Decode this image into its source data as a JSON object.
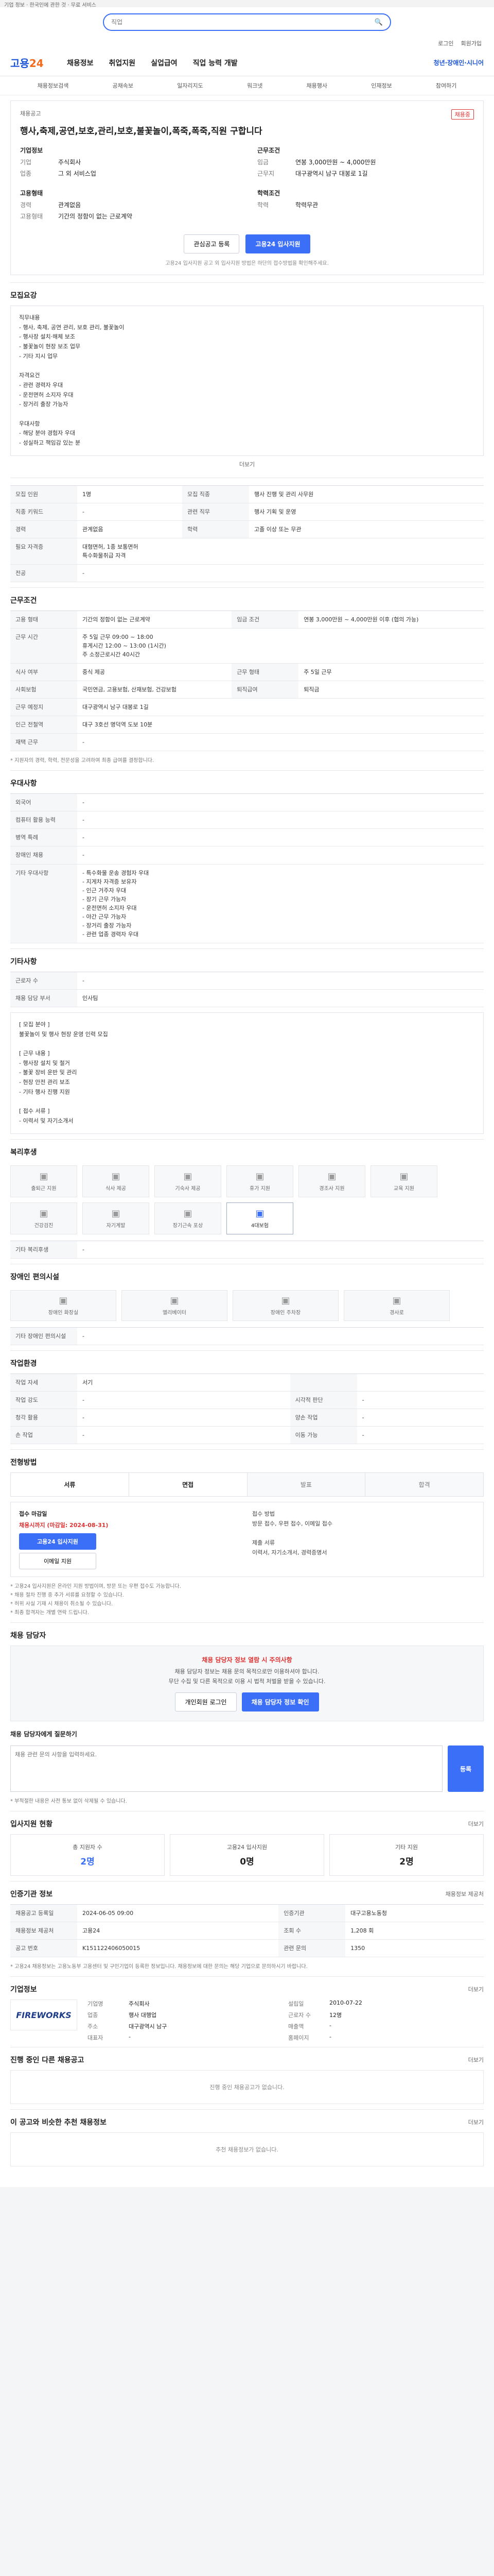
{
  "topnote": "기업 정보 · 한국인에 관한 것 · 무료 서비스",
  "search": {
    "placeholder": "직업",
    "icon": "search-icon"
  },
  "util": [
    "로그인",
    "회원가입"
  ],
  "brand": {
    "logo": "고용",
    "logo_suffix": "24"
  },
  "gnb": {
    "menu": [
      "채용정보",
      "취업지원",
      "실업급여",
      "직업 능력 개발"
    ],
    "extra": "청년·장애인·시니어"
  },
  "subnav": [
    "채용정보검색",
    "공채속보",
    "일자리지도",
    "워크넷",
    "채용행사",
    "인재정보",
    "참여하기"
  ],
  "job": {
    "label": "채용공고",
    "badge": "채용중",
    "title": "행사,축제,공연,보호,관리,보호,불꽃놀이,폭죽,폭죽,직원 구합니다",
    "company_title": "기업정보",
    "company_rows": [
      {
        "k": "기업",
        "v": "주식회사"
      },
      {
        "k": "업종",
        "v": "그 외 서비스업"
      }
    ],
    "cond_title": "근무조건",
    "cond_rows": [
      {
        "k": "임금",
        "v": "연봉 3,000만원 ~ 4,000만원"
      },
      {
        "k": "근무지",
        "v": "대구광역시 남구 대봉로 1길"
      }
    ],
    "career_title": "고용형태",
    "career_rows": [
      {
        "k": "경력",
        "v": "관계없음"
      },
      {
        "k": "고용형태",
        "v": "기간의 정함이 없는 근로계약"
      }
    ],
    "edu_title": "학력조건",
    "edu_rows": [
      {
        "k": "학력",
        "v": "학력무관"
      }
    ],
    "btn_scrap": "관심공고 등록",
    "btn_apply": "고용24 입사지원",
    "note": "고용24 입사지원 공고 외 입사지원 방법은 하단의 접수방법을 확인해주세요."
  },
  "detail": {
    "title": "모집요강",
    "body": "직무내용\n- 행사, 축제, 공연 관리, 보호 관리, 불꽃놀이\n- 행사장 설치·해체 보조\n- 불꽃놀이 현장 보조 업무\n- 기타 지시 업무\n\n자격요건\n- 관련 경력자 우대\n- 운전면허 소지자 우대\n- 장거리 출장 가능자\n\n우대사항\n- 해당 분야 경험자 우대\n- 성실하고 책임감 있는 분",
    "more": "더보기"
  },
  "recruit_table": [
    {
      "k": "모집 인원",
      "v": "1명"
    },
    {
      "k": "모집 직종",
      "v": "행사 진행 및 관리 사무원"
    },
    {
      "k": "직종 키워드",
      "v": "-"
    },
    {
      "k": "관련 직무",
      "v": "행사 기획 및 운영"
    },
    {
      "k": "경력",
      "v": "관계없음"
    },
    {
      "k": "학력",
      "v": "고졸 이상 또는 무관"
    },
    {
      "k": "필요 자격증",
      "v": "대형면허, 1종 보통면허\n특수화물취급 자격"
    },
    {
      "k": "전공",
      "v": "-"
    }
  ],
  "conditions": {
    "title": "근무조건",
    "rows": [
      {
        "k": "고용 형태",
        "v": "기간의 정함이 없는 근로계약"
      },
      {
        "k": "임금 조건",
        "v": "연봉 3,000만원 ~ 4,000만원 이후 (협의 가능)"
      },
      {
        "k": "근무 시간",
        "v": "주 5일 근무 09:00 ~ 18:00\n휴게시간 12:00 ~ 13:00 (1시간)\n주 소정근로시간 40시간"
      },
      {
        "k": "식사 여부",
        "v": "중식 제공"
      },
      {
        "k": "근무 형태",
        "v": "주 5일 근무"
      },
      {
        "k": "사회보험",
        "v": "국민연금, 고용보험, 산재보험, 건강보험"
      },
      {
        "k": "퇴직급여",
        "v": "퇴직금"
      },
      {
        "k": "근무 예정지",
        "v": "대구광역시 남구 대봉로 1길"
      },
      {
        "k": "인근 전철역",
        "v": "대구 3호선 명덕역 도보 10분"
      },
      {
        "k": "재택 근무",
        "v": "-"
      }
    ],
    "note": "* 지원자의 경력, 학력, 전문성을 고려하여 최종 급여를 결정합니다."
  },
  "prefs": {
    "title": "우대사항",
    "rows": [
      {
        "k": "외국어",
        "v": "-"
      },
      {
        "k": "컴퓨터 활용 능력",
        "v": "-"
      },
      {
        "k": "병역 특례",
        "v": "-"
      },
      {
        "k": "장애인 채용",
        "v": "-"
      },
      {
        "k": "기타 우대사항",
        "v": "- 특수화물 운송 경험자 우대\n- 지게차 자격증 보유자\n- 인근 거주자 우대\n- 장기 근무 가능자\n- 운전면허 소지자 우대\n- 야간 근무 가능자\n- 장거리 출장 가능자\n- 관련 업종 경력자 우대"
      }
    ]
  },
  "etc": {
    "title": "기타사항",
    "rows": [
      {
        "k": "근로자 수",
        "v": "-"
      },
      {
        "k": "채용 담당 부서",
        "v": "인사팀"
      }
    ],
    "body": "[ 모집 분야 ]\n불꽃놀이 및 행사 현장 운영 인력 모집\n\n[ 근무 내용 ]\n- 행사장 설치 및 철거\n- 불꽃 장비 운반 및 관리\n- 현장 안전 관리 보조\n- 기타 행사 진행 지원\n\n[ 접수 서류 ]\n- 이력서 및 자기소개서"
  },
  "welfare": {
    "title": "복리후생",
    "cards": [
      {
        "label": "출퇴근 지원",
        "icon": "bus-icon",
        "on": false
      },
      {
        "label": "식사 제공",
        "icon": "meal-icon",
        "on": false
      },
      {
        "label": "기숙사 제공",
        "icon": "home-icon",
        "on": false
      },
      {
        "label": "휴가 지원",
        "icon": "calendar-icon",
        "on": false
      },
      {
        "label": "경조사 지원",
        "icon": "gift-icon",
        "on": false
      },
      {
        "label": "교육 지원",
        "icon": "book-icon",
        "on": false
      },
      {
        "label": "건강검진",
        "icon": "heart-icon",
        "on": false
      },
      {
        "label": "자기계발",
        "icon": "star-icon",
        "on": false
      },
      {
        "label": "장기근속 포상",
        "icon": "trophy-icon",
        "on": false
      },
      {
        "label": "4대보험",
        "icon": "shield-icon",
        "on": true
      }
    ],
    "extra_row": {
      "k": "기타 복리후생",
      "v": "-"
    }
  },
  "disability": {
    "title": "장애인 편의시설",
    "cards": [
      {
        "label": "장애인 화장실",
        "icon": "toilet-icon"
      },
      {
        "label": "엘리베이터",
        "icon": "elevator-icon"
      },
      {
        "label": "장애인 주차장",
        "icon": "parking-icon"
      },
      {
        "label": "경사로",
        "icon": "ramp-icon"
      }
    ],
    "extra_row": {
      "k": "기타 장애인 편의시설",
      "v": "-"
    }
  },
  "workenv": {
    "title": "작업환경",
    "rows": [
      {
        "k": "작업 자세",
        "v": "서기",
        "k2": "",
        "v2": ""
      },
      {
        "k": "작업 강도",
        "v": "-",
        "k2": "시각적 판단",
        "v2": "-"
      },
      {
        "k": "청각 활용",
        "v": "-",
        "k2": "양손 작업",
        "v2": "-"
      },
      {
        "k": "손 작업",
        "v": "-",
        "k2": "이동 가능",
        "v2": "-"
      }
    ]
  },
  "procedure": {
    "title": "전형방법",
    "steps": [
      "서류",
      "면접",
      "발표",
      "합격"
    ],
    "apply_label": "접수 마감일",
    "deadline": "채용시까지 (마감일: 2024-08-31)",
    "btn_apply": "고용24 입사지원",
    "btn_email": "이메일 지원",
    "right": "접수 방법\n방문 접수, 우편 접수, 이메일 접수\n\n제출 서류\n이력서, 자기소개서, 경력증명서",
    "fine": "* 고용24 입사지원은 온라인 지원 방법이며, 방문 또는 우편 접수도 가능합니다.\n* 채용 절차 진행 중 추가 서류를 요청할 수 있습니다.\n* 허위 사실 기재 시 채용이 취소될 수 있습니다.\n* 최종 합격자는 개별 연락 드립니다."
  },
  "contact": {
    "title": "채용 담당자",
    "warn": "채용 담당자 정보 열람 시 주의사항",
    "desc": "채용 담당자 정보는 채용 문의 목적으로만 이용하셔야 합니다.\n무단 수집 및 다른 목적으로 이용 시 법적 처벌을 받을 수 있습니다.",
    "btn_login": "개인회원 로그인",
    "btn_view": "채용 담당자 정보 확인",
    "qa_title": "채용 담당자에게 질문하기",
    "qa_placeholder": "채용 관련 문의 사항을 입력하세요.",
    "qa_btn": "등록",
    "qa_note": "* 부적절한 내용은 사전 통보 없이 삭제될 수 있습니다."
  },
  "apply_status": {
    "title": "입사지원 현황",
    "aux": "더보기",
    "stats": [
      {
        "k": "총 지원자 수",
        "v": "2명"
      },
      {
        "k": "고용24 입사지원",
        "v": "0명"
      },
      {
        "k": "기타 지원",
        "v": "2명"
      }
    ]
  },
  "info": {
    "title": "인증기관 정보",
    "aux": "채용정보 제공처",
    "rows": [
      {
        "k": "채용공고 등록일",
        "v": "2024-06-05 09:00",
        "k2": "인증기관",
        "v2": "대구고용노동청"
      },
      {
        "k": "채용정보 제공처",
        "v": "고용24",
        "k2": "조회 수",
        "v2": "1,208 회"
      },
      {
        "k": "공고 번호",
        "v": "K151122406050015",
        "k2": "관련 문의",
        "v2": "1350"
      }
    ],
    "fine": "* 고용24 채용정보는 고용노동부 고용센터 및 구인기업이 등록한 정보입니다. 채용정보에 대한 문의는 해당 기업으로 문의하시기 바랍니다."
  },
  "company": {
    "title": "기업정보",
    "aux": "더보기",
    "logo_text": "FIREWORKS",
    "rows": [
      {
        "k": "기업명",
        "v": "주식회사",
        "k2": "설립일",
        "v2": "2010-07-22"
      },
      {
        "k": "업종",
        "v": "행사 대행업",
        "k2": "근로자 수",
        "v2": "12명"
      },
      {
        "k": "주소",
        "v": "대구광역시 남구",
        "k2": "매출액",
        "v2": "-"
      },
      {
        "k": "대표자",
        "v": "-",
        "k2": "홈페이지",
        "v2": "-"
      }
    ]
  },
  "related": {
    "title": "진행 중인 다른 채용공고",
    "aux": "더보기",
    "empty": "진행 중인 채용공고가 없습니다."
  },
  "recommend": {
    "title": "이 공고와 비슷한 추천 채용정보",
    "aux": "더보기",
    "empty": "추천 채용정보가 없습니다."
  }
}
